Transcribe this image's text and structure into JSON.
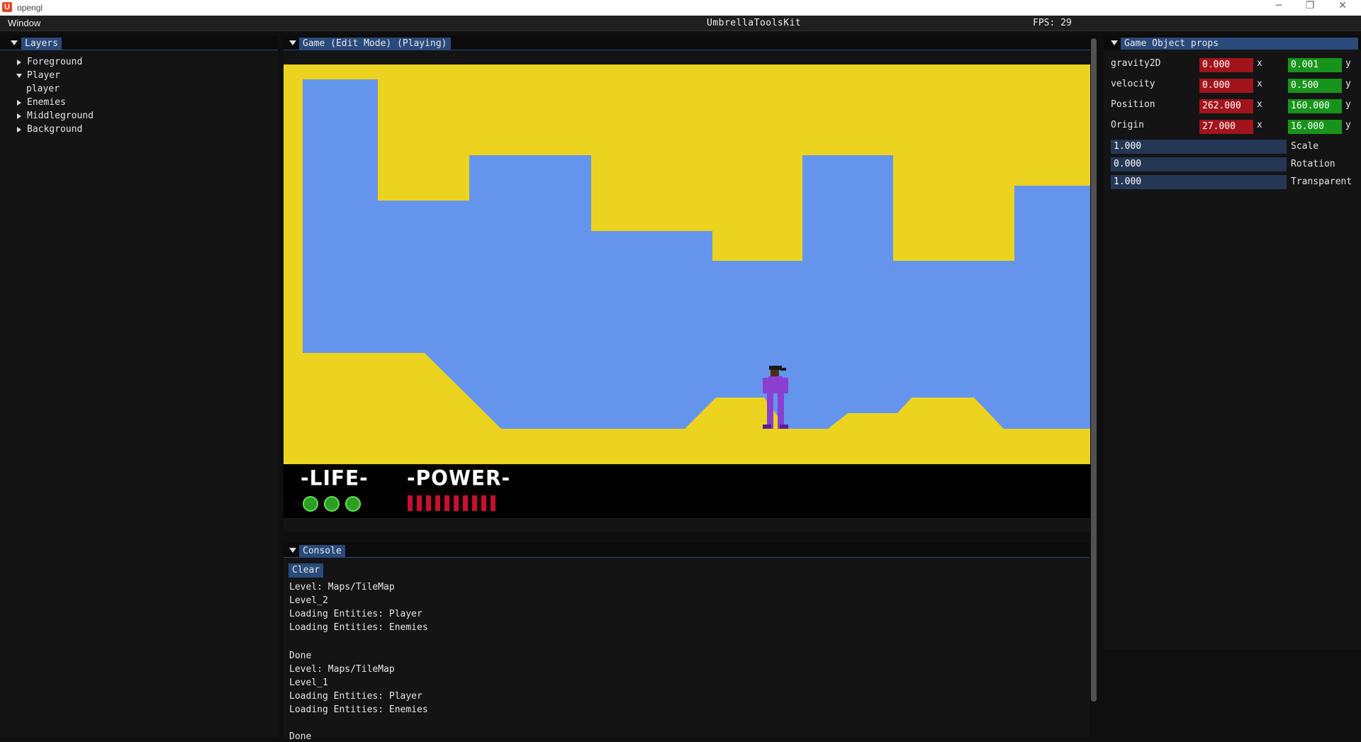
{
  "window": {
    "title": "opengl",
    "minimize_glyph": "─",
    "maximize_glyph": "❐",
    "close_glyph": "✕"
  },
  "menubar": {
    "menu_window": "Window",
    "app_title": "UmbrellaToolsKit",
    "fps": "FPS: 29"
  },
  "layers": {
    "tab": "Layers",
    "items": [
      {
        "label": "Foreground",
        "expanded": false
      },
      {
        "label": "Player",
        "expanded": true
      },
      {
        "label": "player",
        "child": true
      },
      {
        "label": "Enemies",
        "expanded": false
      },
      {
        "label": "Middleground",
        "expanded": false
      },
      {
        "label": "Background",
        "expanded": false
      }
    ]
  },
  "game": {
    "tab": "Game (Edit Mode) (Playing)",
    "colors": {
      "sky": "#6495ed",
      "ground": "#ecd31f",
      "hud_bg": "#000000",
      "life": "#2aa020",
      "power": "#c8102e"
    },
    "hud": {
      "life_label": "-LIFE-",
      "power_label": "-POWER-",
      "life_count": 3,
      "power_segments": 10
    }
  },
  "console": {
    "tab": "Console",
    "clear_label": "Clear",
    "lines": [
      "Level: Maps/TileMap",
      "Level_2",
      "Loading Entities: Player",
      "Loading Entities: Enemies",
      "",
      "Done",
      "Level: Maps/TileMap",
      "Level_1",
      "Loading Entities: Player",
      "Loading Entities: Enemies",
      "",
      "Done"
    ]
  },
  "props": {
    "tab": "Game Object props",
    "vectors": [
      {
        "label": "gravity2D",
        "x": "0.000",
        "y": "0.001"
      },
      {
        "label": "velocity",
        "x": "0.000",
        "y": "0.500"
      },
      {
        "label": "Position",
        "x": "262.000",
        "y": "160.000"
      },
      {
        "label": "Origin",
        "x": "27.000",
        "y": "16.000"
      }
    ],
    "axis_x": "x",
    "axis_y": "y",
    "scalars": [
      {
        "label": "Scale",
        "value": "1.000"
      },
      {
        "label": "Rotation",
        "value": "0.000"
      },
      {
        "label": "Transparent",
        "value": "1.000"
      }
    ]
  }
}
